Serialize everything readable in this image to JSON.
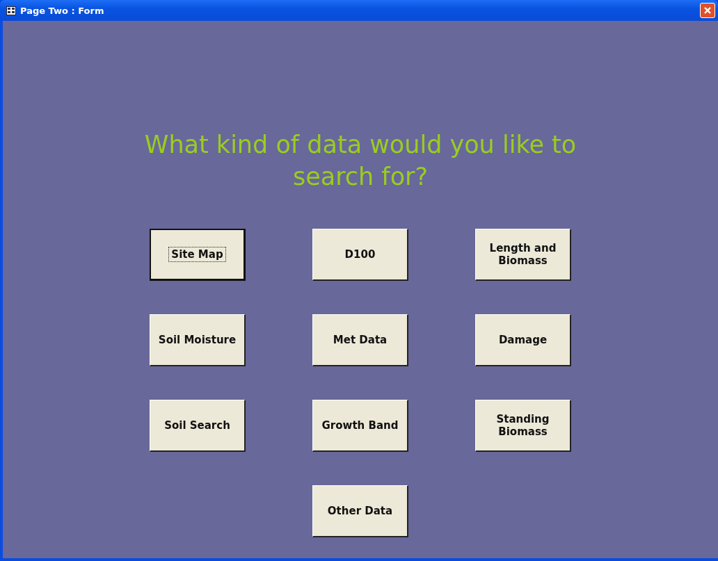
{
  "window": {
    "title": "Page Two : Form"
  },
  "heading": "What kind of data would you like to search for?",
  "buttons": [
    {
      "label": "Site Map",
      "focused": true
    },
    {
      "label": "D100",
      "focused": false
    },
    {
      "label": "Length and Biomass",
      "focused": false
    },
    {
      "label": "Soil Moisture",
      "focused": false
    },
    {
      "label": "Met Data",
      "focused": false
    },
    {
      "label": "Damage",
      "focused": false
    },
    {
      "label": "Soil Search",
      "focused": false
    },
    {
      "label": "Growth Band",
      "focused": false
    },
    {
      "label": "Standing Biomass",
      "focused": false
    },
    {
      "label": "Other Data",
      "focused": false
    }
  ]
}
